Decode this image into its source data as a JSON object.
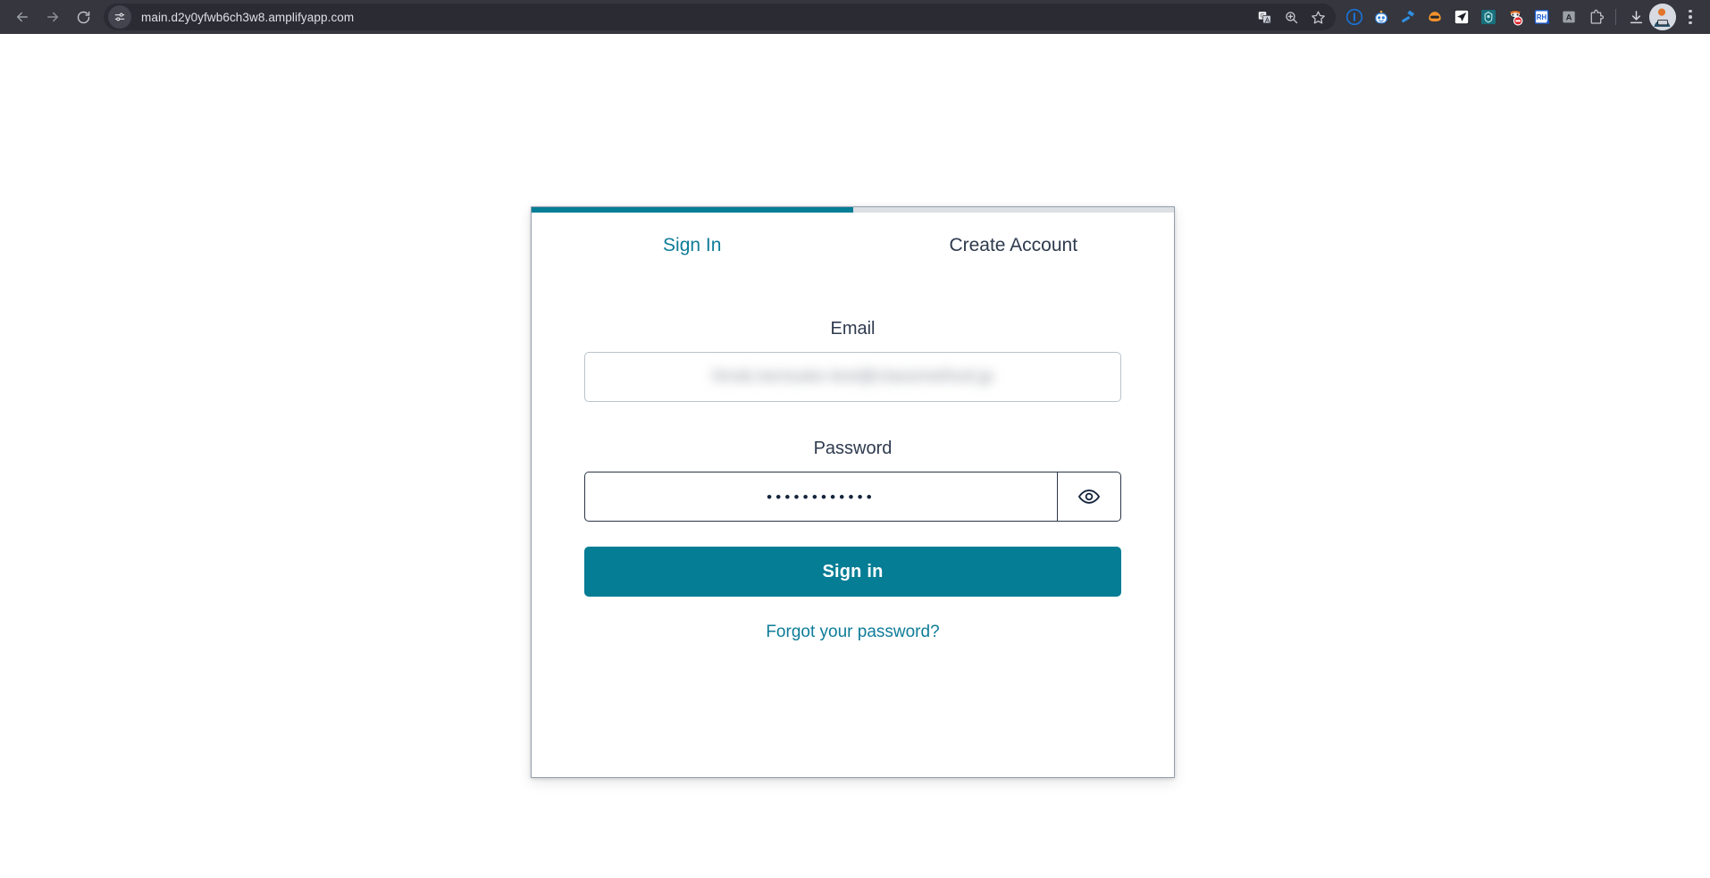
{
  "browser": {
    "back_icon": "arrow-left-icon",
    "forward_icon": "arrow-right-icon",
    "reload_icon": "reload-icon",
    "site_info_icon": "tune-sliders-icon",
    "url": "main.d2y0yfwb6ch3w8.amplifyapp.com",
    "omnibox_actions": [
      {
        "name": "translate-icon",
        "label": "Translate this page"
      },
      {
        "name": "zoom-icon",
        "label": "Zoom"
      },
      {
        "name": "bookmark-star-icon",
        "label": "Bookmark this tab"
      }
    ],
    "extensions": [
      {
        "name": "onepassword-extension-icon",
        "label": "1Password"
      },
      {
        "name": "bot-avatar-extension-icon",
        "label": "Bot assistant"
      },
      {
        "name": "blue-hammer-extension-icon",
        "label": "Developer tool"
      },
      {
        "name": "orange-mask-extension-icon",
        "label": "Privacy mask"
      },
      {
        "name": "paper-plane-extension-icon",
        "label": "Send"
      },
      {
        "name": "teal-badge-extension-icon",
        "label": "Teal badge extension"
      },
      {
        "name": "blocker-extension-icon",
        "label": "Content blocker"
      },
      {
        "name": "rh-extension-icon",
        "label": "RH"
      },
      {
        "name": "letter-a-extension-icon",
        "label": "A"
      },
      {
        "name": "extensions-puzzle-icon",
        "label": "Extensions"
      }
    ],
    "download_icon": "download-icon",
    "avatar_icon": "profile-avatar",
    "menu_icon": "kebab-menu-icon"
  },
  "auth_card": {
    "tabs": [
      {
        "label": "Sign In",
        "active": true
      },
      {
        "label": "Create Account",
        "active": false
      }
    ],
    "email": {
      "label": "Email",
      "value": "hiroki.kensuke-test@classmethod.jp",
      "placeholder": "",
      "redacted": true
    },
    "password": {
      "label": "Password",
      "masked_value": "••••••••••••",
      "character_count": 12,
      "toggle_icon": "eye-icon",
      "placeholder": ""
    },
    "submit_label": "Sign in",
    "forgot_password_label": "Forgot your password?"
  },
  "colors": {
    "accent_teal": "#047d95",
    "link_teal": "#0e7c99",
    "tab_inactive_text": "#2e3a4e",
    "tab_inactive_bar": "#dcdfe3",
    "card_border": "#93a0ae",
    "chrome_background": "#35363e",
    "omnibox_background": "#2a2b33",
    "page_background": "#ffffff"
  }
}
